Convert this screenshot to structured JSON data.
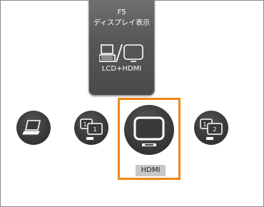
{
  "card": {
    "key": "F5",
    "title": "ディスプレイ表示",
    "mode": "LCD+HDMI"
  },
  "modes": [
    {
      "id": "laptop",
      "icon": "laptop-icon"
    },
    {
      "id": "duplicate",
      "icon": "duplicate-display-icon",
      "badges": [
        "1",
        "1"
      ]
    },
    {
      "id": "hdmi",
      "icon": "monitor-icon",
      "label": "HDMI",
      "selected": true
    },
    {
      "id": "extend",
      "icon": "extend-display-icon",
      "badges": [
        "1",
        "2"
      ]
    }
  ],
  "colors": {
    "selection": "#f0861a",
    "card": "#585858",
    "mode_button": "#3a3a3a"
  }
}
